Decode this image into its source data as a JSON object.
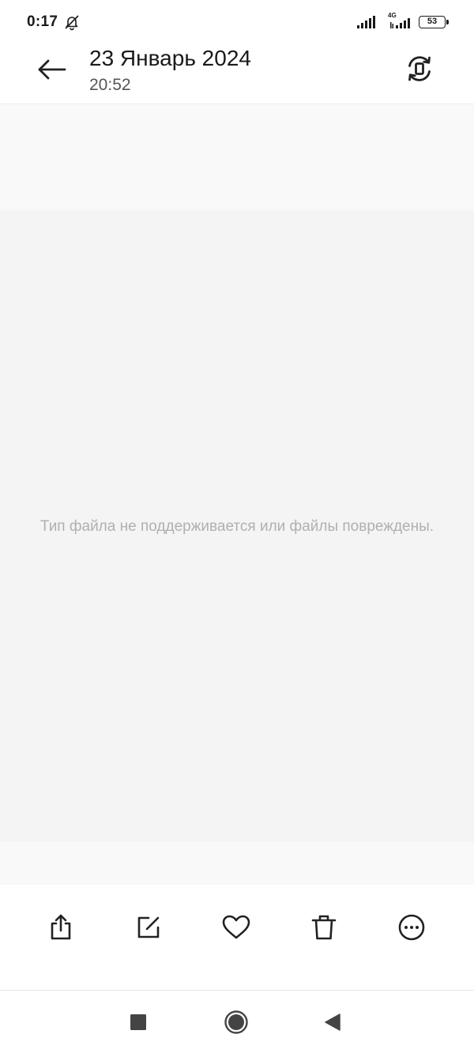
{
  "status_bar": {
    "time": "0:17",
    "network": "4G",
    "battery": "53",
    "icons": [
      "mute-bell-icon",
      "signal-icon",
      "signal-4g-icon",
      "battery-icon"
    ]
  },
  "header": {
    "date": "23 Январь 2024",
    "time": "20:52",
    "icons": [
      "back-arrow-icon",
      "rotate-icon"
    ]
  },
  "viewer": {
    "message": "Тип файла не поддерживается или файлы повреждены."
  },
  "toolbar": {
    "icons": [
      "share-icon",
      "edit-icon",
      "heart-icon",
      "trash-icon",
      "more-icon"
    ]
  },
  "nav_bar": {
    "icons": [
      "recent-apps-icon",
      "home-icon",
      "back-triangle-icon"
    ]
  },
  "colors": {
    "background": "#ffffff",
    "viewer_background": "#f4f4f4",
    "icon": "#222222",
    "message_text": "#b0b0b0"
  }
}
